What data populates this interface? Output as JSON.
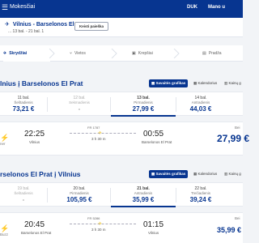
{
  "topbar": {
    "brand": "Mokesčiai",
    "menu_icon": "hamburger-icon",
    "currency": "DUK",
    "account": "Mano u"
  },
  "search": {
    "route": "Vilnius - Barselonos El Prat",
    "details": "... 13 bal. - 21 bal.    1",
    "edit_label": "Keisti paieška"
  },
  "steps": [
    {
      "label": "Skrydžiai",
      "icon": "plane-icon",
      "active": true
    },
    {
      "label": "Vietos",
      "icon": "seat-icon",
      "active": false
    },
    {
      "label": "Krepšiai",
      "icon": "bag-icon",
      "active": false
    },
    {
      "label": "Pradža",
      "icon": "car-icon",
      "active": false
    }
  ],
  "outbound": {
    "title": "lnius į Barselonos El Prat",
    "tabs": [
      "Savaitės grafikas",
      "Kalendorius",
      "Kainų g"
    ],
    "dates": [
      {
        "date": "11 bal.",
        "weekday": "Šeštadienis",
        "price": "73,21 €",
        "muted": false,
        "selected": false
      },
      {
        "date": "12 bal.",
        "weekday": "Sekmadienis",
        "price": "-",
        "muted": true,
        "selected": false
      },
      {
        "date": "13 bal.",
        "weekday": "Pirmadienis",
        "price": "27,99 €",
        "muted": false,
        "selected": true
      },
      {
        "date": "14 bal.",
        "weekday": "Antradienis",
        "price": "44,03 €",
        "muted": false,
        "selected": false
      }
    ],
    "flight": {
      "dep_time": "22:25",
      "dep_city": "Vilnius",
      "flight_no": "FR 1787",
      "duration": "3 h 30 m",
      "arr_time": "00:55",
      "arr_city": "Barselonos El Prat",
      "operator": "ner",
      "price_label": "Bei",
      "price": "27,99 €"
    }
  },
  "inbound": {
    "title": "rselonos El Prat į Vilnius",
    "tabs": [
      "Savaitės grafikas",
      "Kalendorius",
      "Kainų g"
    ],
    "dates": [
      {
        "date": "19 bal.",
        "weekday": "Šeštadienis",
        "price": "-",
        "muted": true,
        "selected": false
      },
      {
        "date": "20 bal.",
        "weekday": "Pirmadienis",
        "price": "105,95 €",
        "muted": false,
        "selected": false
      },
      {
        "date": "21 bal.",
        "weekday": "Antradienis",
        "price": "35,99 €",
        "muted": false,
        "selected": true
      },
      {
        "date": "22 bal.",
        "weekday": "Trečiadienis",
        "price": "39,24 €",
        "muted": false,
        "selected": false
      }
    ],
    "flight": {
      "dep_time": "20:45",
      "dep_city": "Barselonos El Prat",
      "flight_no": "FR 5286",
      "duration": "3 h 30 m",
      "arr_time": "01:15",
      "arr_city": "Vilnius",
      "operator": "Buzz",
      "price_label": "Bei",
      "price": "35,99 €"
    }
  },
  "colors": {
    "brand_blue": "#073590",
    "accent_yellow": "#f1c933"
  }
}
